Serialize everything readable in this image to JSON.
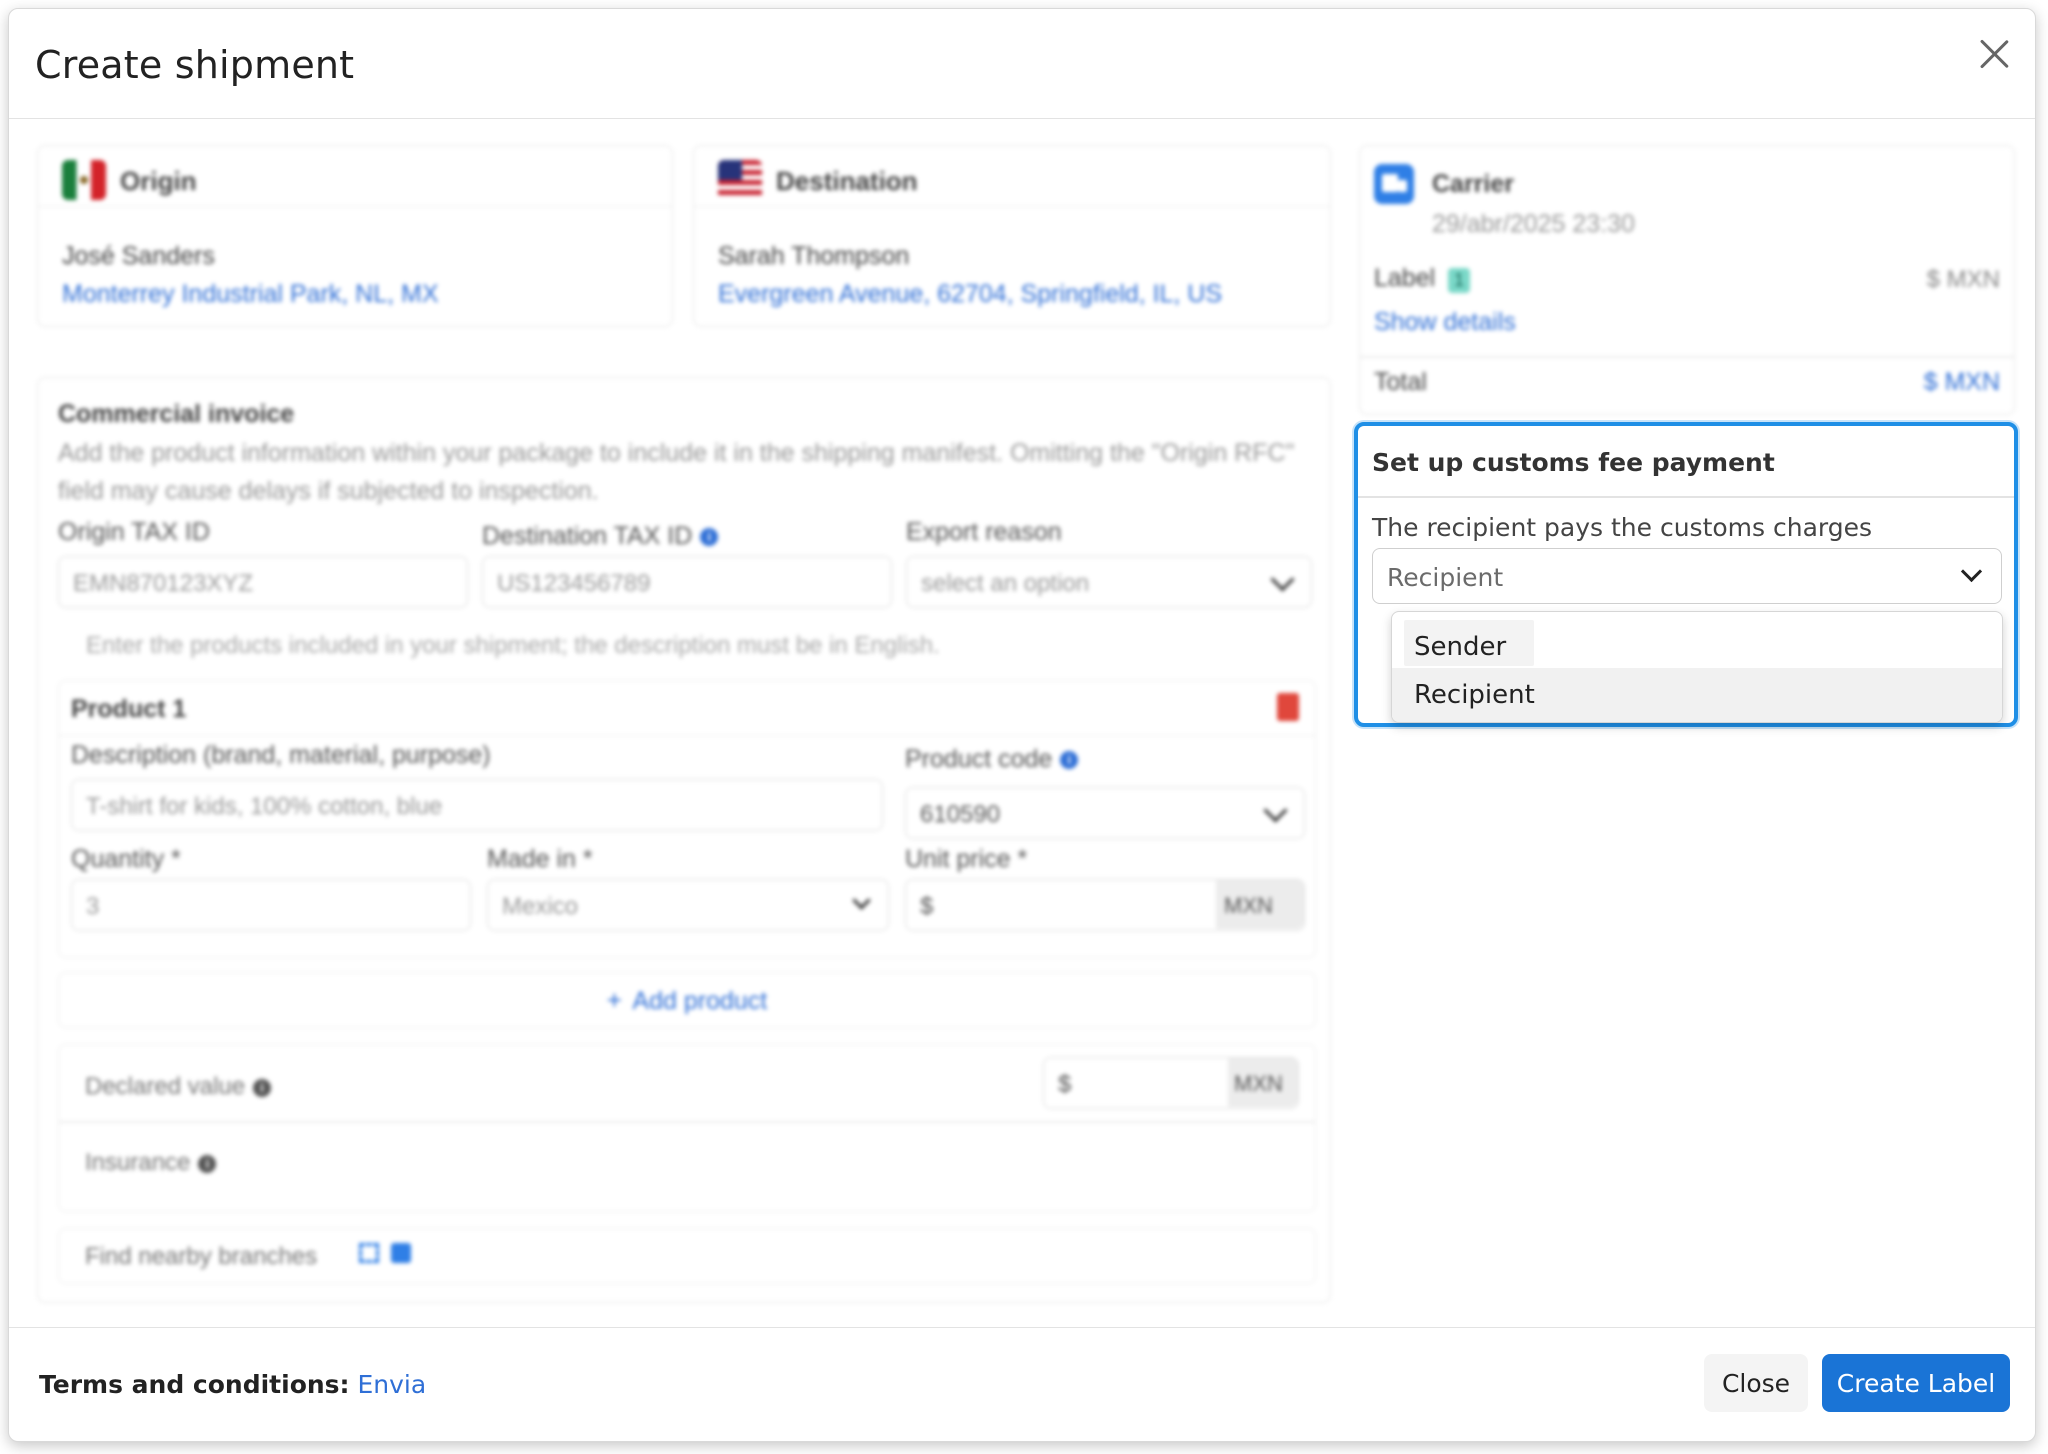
{
  "modal": {
    "title": "Create shipment"
  },
  "origin": {
    "title": "Origin",
    "name": "José Sanders",
    "address": "Monterrey Industrial Park, NL, MX"
  },
  "destination": {
    "title": "Destination",
    "name": "Sarah Thompson",
    "address": "Evergreen Avenue, 62704, Springfield, IL, US"
  },
  "carrier": {
    "title": "Carrier",
    "date": "29/abr/2025 23:30",
    "label_text": "Label",
    "label_badge": "1",
    "label_amount": "$ MXN",
    "show_details": "Show details",
    "total_label": "Total",
    "total_amount": "$ MXN"
  },
  "invoice": {
    "title": "Commercial invoice",
    "description": "Add the product information within your package to include it in the shipping manifest. Omitting the \"Origin RFC\" field may cause delays if subjected to inspection.",
    "origin_tax_label": "Origin TAX ID",
    "origin_tax_value": "EMN870123XYZ",
    "dest_tax_label": "Destination TAX ID",
    "dest_tax_value": "US123456789",
    "export_reason_label": "Export reason",
    "export_reason_placeholder": "select an option",
    "products_hint": "Enter the products included in your shipment; the description must be in English."
  },
  "product": {
    "title": "Product 1",
    "description_label": "Description (brand, material, purpose)",
    "description_placeholder": "T-shirt for kids, 100% cotton, blue",
    "code_label": "Product code",
    "code_value": "610590",
    "quantity_label": "Quantity *",
    "quantity_value": "3",
    "made_in_label": "Made in *",
    "made_in_value": "Mexico",
    "unit_price_label": "Unit price *",
    "unit_price_prefix": "$",
    "unit_price_currency": "MXN"
  },
  "add_product": "Add product",
  "declared_value": {
    "label": "Declared value",
    "prefix": "$",
    "currency": "MXN"
  },
  "insurance": {
    "label": "Insurance"
  },
  "nearby": {
    "label": "Find nearby branches"
  },
  "customs": {
    "title": "Set up customs fee payment",
    "description": "The recipient pays the customs charges",
    "selected": "Recipient",
    "options": [
      "Sender",
      "Recipient"
    ]
  },
  "footer": {
    "terms_label": "Terms and conditions:",
    "terms_link": "Envia",
    "close_label": "Close",
    "create_label": "Create Label"
  },
  "colors": {
    "accent": "#1a74d6",
    "highlight_border": "#1f8fe6",
    "link": "#2f6fd6",
    "delete": "#e0473c"
  }
}
